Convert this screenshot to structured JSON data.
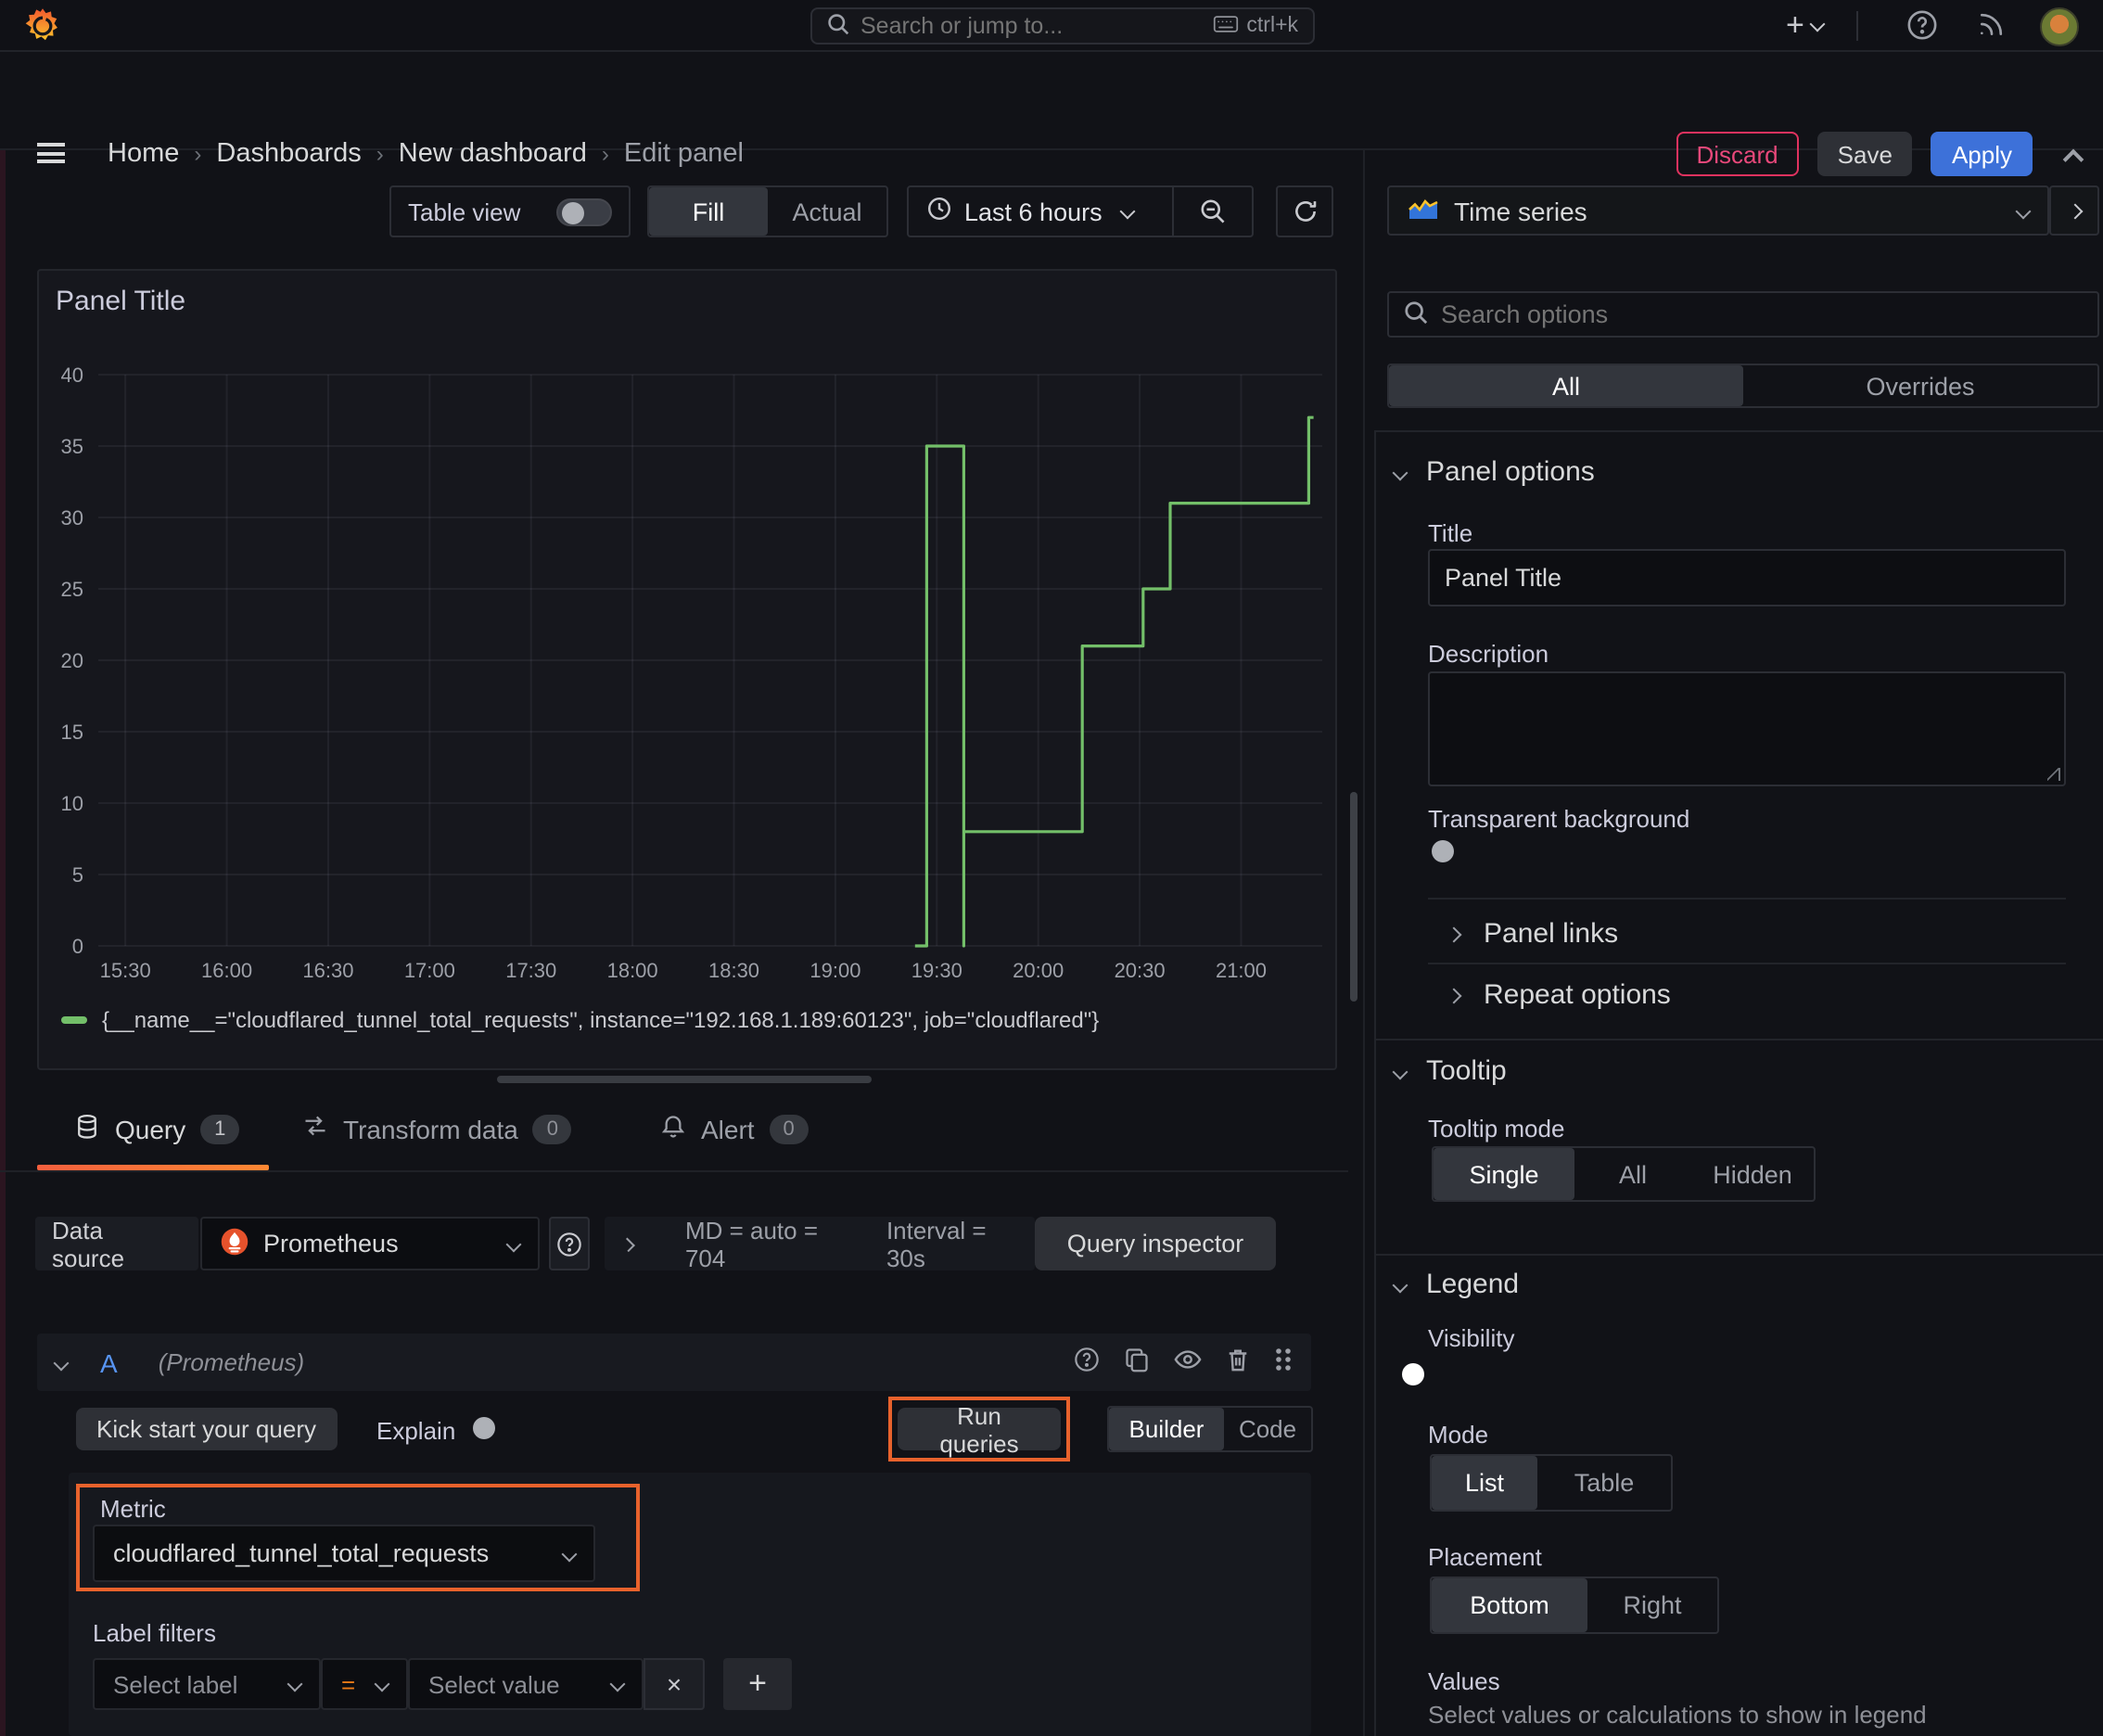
{
  "topnav": {
    "search_placeholder": "Search or jump to...",
    "search_shortcut": "ctrl+k"
  },
  "breadcrumb": {
    "items": [
      "Home",
      "Dashboards",
      "New dashboard",
      "Edit panel"
    ],
    "actions": {
      "discard": "Discard",
      "save": "Save",
      "apply": "Apply"
    }
  },
  "toolbar": {
    "table_view_label": "Table view",
    "fill_label": "Fill",
    "actual_label": "Actual",
    "time_range_label": "Last 6 hours"
  },
  "chart_data": {
    "type": "line",
    "title": "Panel Title",
    "x_axis": {
      "min": "15:22",
      "max": "21:24",
      "ticks": [
        "15:30",
        "16:00",
        "16:30",
        "17:00",
        "17:30",
        "18:00",
        "18:30",
        "19:00",
        "19:30",
        "20:00",
        "20:30",
        "21:00"
      ]
    },
    "y_axis": {
      "min": 0,
      "max": 40,
      "ticks": [
        0,
        5,
        10,
        15,
        20,
        25,
        30,
        35,
        40
      ]
    },
    "grid": true,
    "legend_position": "bottom",
    "series": [
      {
        "name": "{__name__=\"cloudflared_tunnel_total_requests\", instance=\"192.168.1.189:60123\", job=\"cloudflared\"}",
        "color": "#73bf69",
        "points": [
          [
            "19:24",
            0
          ],
          [
            "19:27",
            0
          ],
          [
            "19:27",
            35
          ],
          [
            "19:38",
            35
          ],
          [
            "19:38",
            0
          ],
          [
            "19:38",
            8
          ],
          [
            "20:13",
            8
          ],
          [
            "20:13",
            21
          ],
          [
            "20:31",
            21
          ],
          [
            "20:31",
            25
          ],
          [
            "20:39",
            25
          ],
          [
            "20:39",
            31
          ],
          [
            "21:20",
            31
          ],
          [
            "21:20",
            37
          ],
          [
            "21:21",
            37
          ]
        ]
      }
    ]
  },
  "tabs": {
    "query": {
      "label": "Query",
      "count": "1"
    },
    "transform": {
      "label": "Transform data",
      "count": "0"
    },
    "alert": {
      "label": "Alert",
      "count": "0"
    }
  },
  "datasource_row": {
    "label": "Data source",
    "name": "Prometheus",
    "md_text": "MD = auto = 704",
    "interval_text": "Interval = 30s",
    "inspector_label": "Query inspector"
  },
  "query_editor": {
    "ref_id": "A",
    "ds_hint": "(Prometheus)",
    "kickstart_label": "Kick start your query",
    "explain_label": "Explain",
    "run_label": "Run queries",
    "builder_label": "Builder",
    "code_label": "Code",
    "metric_label": "Metric",
    "metric_value": "cloudflared_tunnel_total_requests",
    "filters_label": "Label filters",
    "select_label_placeholder": "Select label",
    "operator": "=",
    "select_value_placeholder": "Select value"
  },
  "sidebar": {
    "viz_type": "Time series",
    "search_placeholder": "Search options",
    "tab_all": "All",
    "tab_overrides": "Overrides",
    "panel_options": {
      "heading": "Panel options",
      "title_label": "Title",
      "title_value": "Panel Title",
      "description_label": "Description",
      "transparent_label": "Transparent background"
    },
    "links_label": "Panel links",
    "repeat_label": "Repeat options",
    "tooltip": {
      "heading": "Tooltip",
      "mode_label": "Tooltip mode",
      "options": [
        "Single",
        "All",
        "Hidden"
      ]
    },
    "legend": {
      "heading": "Legend",
      "visibility_label": "Visibility",
      "mode_label": "Mode",
      "modes": [
        "List",
        "Table"
      ],
      "placement_label": "Placement",
      "placements": [
        "Bottom",
        "Right"
      ],
      "values_label": "Values",
      "values_help": "Select values or calculations to show in legend"
    }
  },
  "annotations": {
    "highlight_color": "#e8622c"
  }
}
